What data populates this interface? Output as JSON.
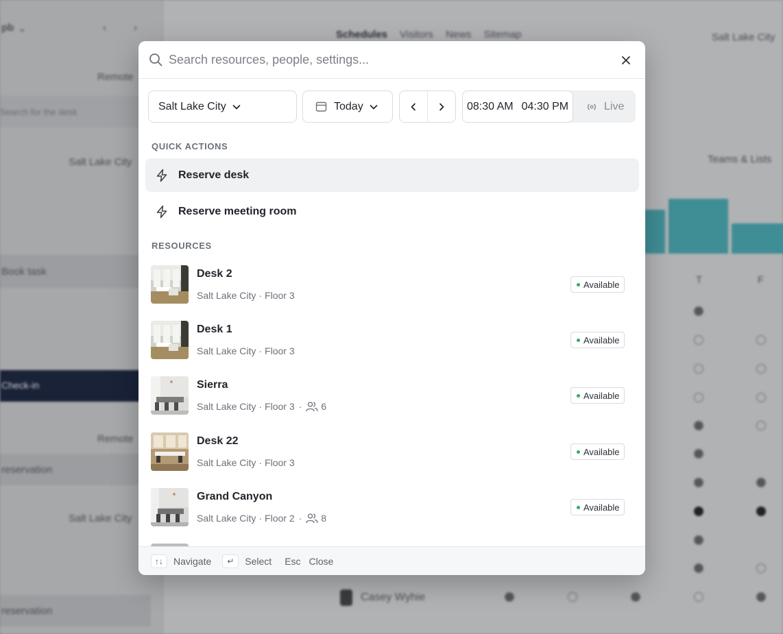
{
  "background": {
    "sidebar": {
      "header": "pb",
      "remote_top": "Remote",
      "search_placeholder": "Search for the desk",
      "location_1": "Salt Lake City",
      "item_band": "Book task",
      "checkin": "Check-in",
      "remote_2": "Remote",
      "reservation_1": "reservation",
      "location_2": "Salt Lake City",
      "reservation_2": "reservation"
    },
    "main": {
      "tabs": [
        "Schedules",
        "Visitors",
        "News",
        "Sitemap"
      ],
      "header_right": "Salt Lake City",
      "teams_label": "Teams & Lists",
      "bottom_person": "Casey Wyhie",
      "col_labels": [
        "T",
        "F"
      ]
    }
  },
  "modal": {
    "search": {
      "placeholder": "Search resources, people, settings..."
    },
    "filters": {
      "location": "Salt Lake City",
      "date": "Today",
      "start_time": "08:30 AM",
      "end_time": "04:30 PM",
      "live": "Live"
    },
    "quick_actions": {
      "label": "QUICK ACTIONS",
      "items": [
        {
          "label": "Reserve desk"
        },
        {
          "label": "Reserve meeting room"
        }
      ]
    },
    "resources": {
      "label": "RESOURCES",
      "items": [
        {
          "name": "Desk 2",
          "city": "Salt Lake City",
          "floor": "Floor 3",
          "capacity": "",
          "status": "Available"
        },
        {
          "name": "Desk 1",
          "city": "Salt Lake City",
          "floor": "Floor 3",
          "capacity": "",
          "status": "Available"
        },
        {
          "name": "Sierra",
          "city": "Salt Lake City",
          "floor": "Floor 3",
          "capacity": "6",
          "status": "Available"
        },
        {
          "name": "Desk 22",
          "city": "Salt Lake City",
          "floor": "Floor 3",
          "capacity": "",
          "status": "Available"
        },
        {
          "name": "Grand Canyon",
          "city": "Salt Lake City",
          "floor": "Floor 2",
          "capacity": "8",
          "status": "Available"
        }
      ]
    },
    "footer": {
      "navigate_key": "↑↓",
      "navigate": "Navigate",
      "select_key": "↵",
      "select": "Select",
      "close_key": "Esc",
      "close": "Close"
    }
  },
  "colors": {
    "accent_teal": "#3f8d95",
    "available_dot": "#39a86b",
    "active_row": "#f0f1f3"
  }
}
